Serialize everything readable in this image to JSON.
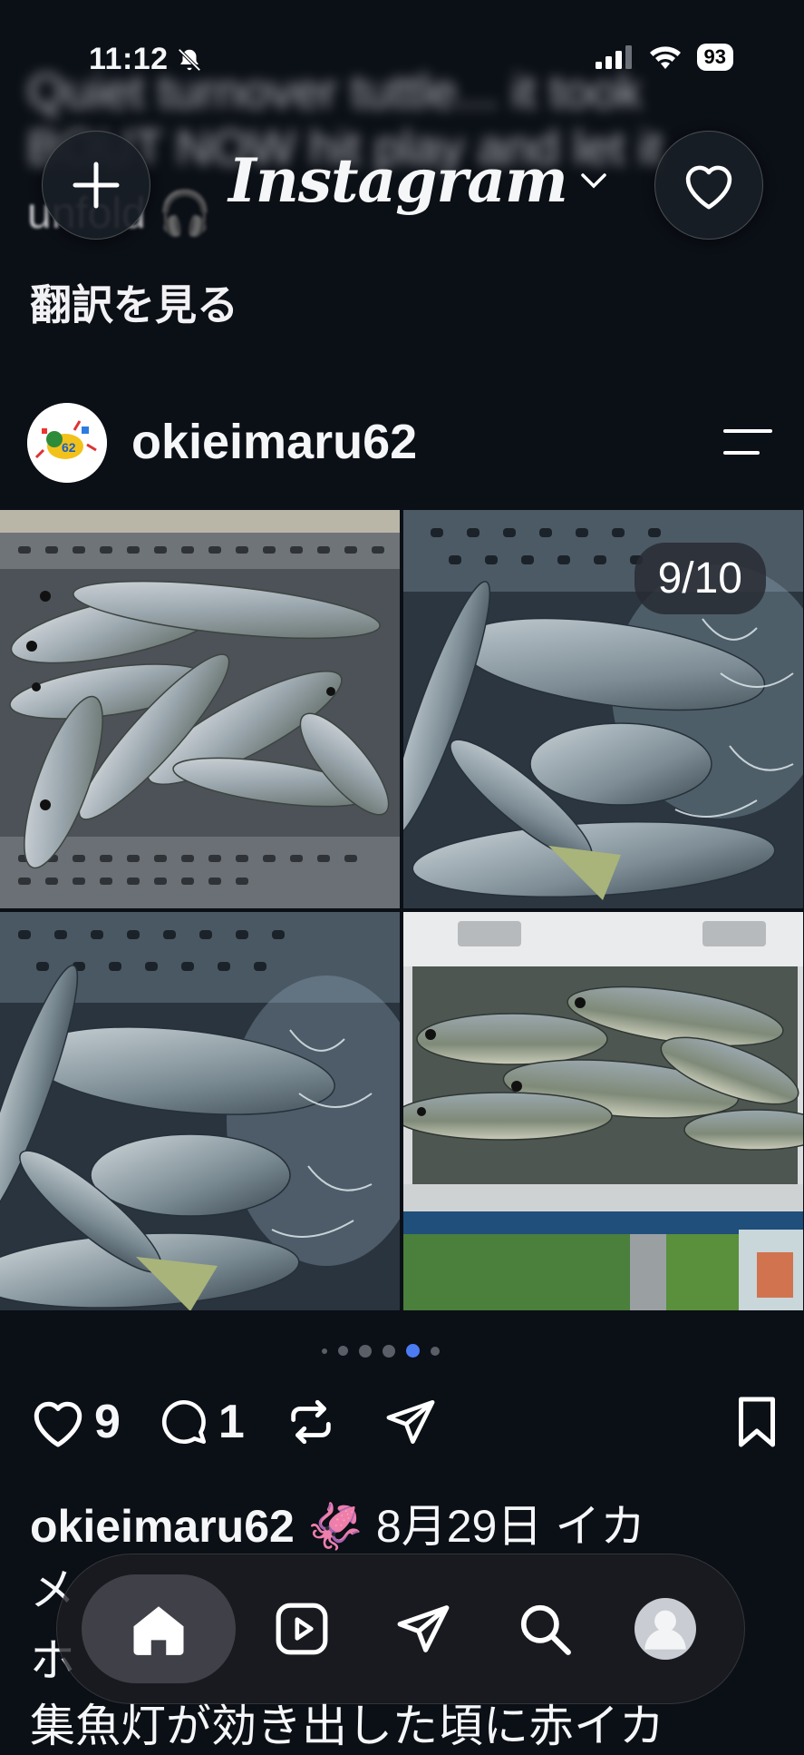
{
  "status_bar": {
    "time": "11:12",
    "battery": "93"
  },
  "caption_fragments": {
    "line1": "Quiet turnover tuttle... it took",
    "line2": "BOUT NOW hit play and let it",
    "line3": "unfold 🎧"
  },
  "translate_label": "翻訳を見る",
  "header": {
    "logo": "Instagram"
  },
  "post": {
    "username": "okieimaru62",
    "counter": "9/10",
    "likes": "9",
    "comments": "1",
    "caption_username": "okieimaru62",
    "caption_emoji": "🦑",
    "caption_line1": "8月29日 イカ",
    "caption_line2": "メ",
    "caption_line3": "ホ",
    "caption_line4": "集魚灯が効き出した頃に赤イカ"
  },
  "carousel": {
    "dot_count": 6,
    "active_index": 4
  },
  "colors": {
    "background": "#0b0f16",
    "accent_dot": "#4c7cf3"
  }
}
